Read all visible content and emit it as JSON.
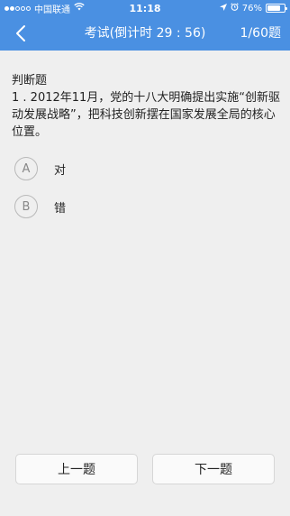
{
  "status_bar": {
    "carrier": "中国联通",
    "time": "11:18",
    "battery_percent_text": "76%",
    "battery_level": 0.76
  },
  "nav": {
    "title": "考试(倒计时 29 : 56)",
    "progress": "1/60题"
  },
  "question": {
    "type_label": "判断题",
    "text": "1 . 2012年11月，党的十八大明确提出实施“创新驱动发展战略”，把科技创新摆在国家发展全局的核心位置。"
  },
  "options": [
    {
      "letter": "A",
      "label": "对"
    },
    {
      "letter": "B",
      "label": "错"
    }
  ],
  "buttons": {
    "prev": "上一题",
    "next": "下一题"
  },
  "colors": {
    "accent": "#4a90e2",
    "background": "#efefef"
  }
}
